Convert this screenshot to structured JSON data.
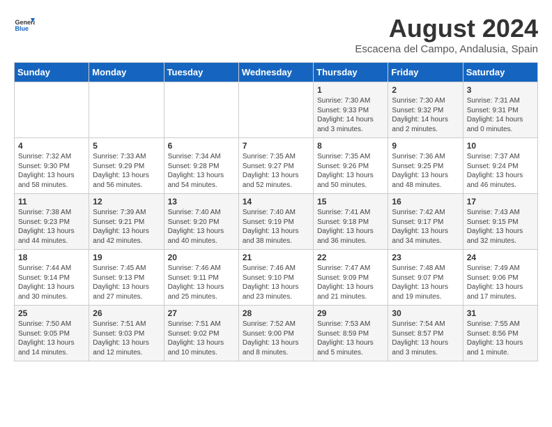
{
  "header": {
    "logo_general": "General",
    "logo_blue": "Blue",
    "month_year": "August 2024",
    "location": "Escacena del Campo, Andalusia, Spain"
  },
  "days_of_week": [
    "Sunday",
    "Monday",
    "Tuesday",
    "Wednesday",
    "Thursday",
    "Friday",
    "Saturday"
  ],
  "weeks": [
    [
      {
        "day": "",
        "content": ""
      },
      {
        "day": "",
        "content": ""
      },
      {
        "day": "",
        "content": ""
      },
      {
        "day": "",
        "content": ""
      },
      {
        "day": "1",
        "content": "Sunrise: 7:30 AM\nSunset: 9:33 PM\nDaylight: 14 hours\nand 3 minutes."
      },
      {
        "day": "2",
        "content": "Sunrise: 7:30 AM\nSunset: 9:32 PM\nDaylight: 14 hours\nand 2 minutes."
      },
      {
        "day": "3",
        "content": "Sunrise: 7:31 AM\nSunset: 9:31 PM\nDaylight: 14 hours\nand 0 minutes."
      }
    ],
    [
      {
        "day": "4",
        "content": "Sunrise: 7:32 AM\nSunset: 9:30 PM\nDaylight: 13 hours\nand 58 minutes."
      },
      {
        "day": "5",
        "content": "Sunrise: 7:33 AM\nSunset: 9:29 PM\nDaylight: 13 hours\nand 56 minutes."
      },
      {
        "day": "6",
        "content": "Sunrise: 7:34 AM\nSunset: 9:28 PM\nDaylight: 13 hours\nand 54 minutes."
      },
      {
        "day": "7",
        "content": "Sunrise: 7:35 AM\nSunset: 9:27 PM\nDaylight: 13 hours\nand 52 minutes."
      },
      {
        "day": "8",
        "content": "Sunrise: 7:35 AM\nSunset: 9:26 PM\nDaylight: 13 hours\nand 50 minutes."
      },
      {
        "day": "9",
        "content": "Sunrise: 7:36 AM\nSunset: 9:25 PM\nDaylight: 13 hours\nand 48 minutes."
      },
      {
        "day": "10",
        "content": "Sunrise: 7:37 AM\nSunset: 9:24 PM\nDaylight: 13 hours\nand 46 minutes."
      }
    ],
    [
      {
        "day": "11",
        "content": "Sunrise: 7:38 AM\nSunset: 9:23 PM\nDaylight: 13 hours\nand 44 minutes."
      },
      {
        "day": "12",
        "content": "Sunrise: 7:39 AM\nSunset: 9:21 PM\nDaylight: 13 hours\nand 42 minutes."
      },
      {
        "day": "13",
        "content": "Sunrise: 7:40 AM\nSunset: 9:20 PM\nDaylight: 13 hours\nand 40 minutes."
      },
      {
        "day": "14",
        "content": "Sunrise: 7:40 AM\nSunset: 9:19 PM\nDaylight: 13 hours\nand 38 minutes."
      },
      {
        "day": "15",
        "content": "Sunrise: 7:41 AM\nSunset: 9:18 PM\nDaylight: 13 hours\nand 36 minutes."
      },
      {
        "day": "16",
        "content": "Sunrise: 7:42 AM\nSunset: 9:17 PM\nDaylight: 13 hours\nand 34 minutes."
      },
      {
        "day": "17",
        "content": "Sunrise: 7:43 AM\nSunset: 9:15 PM\nDaylight: 13 hours\nand 32 minutes."
      }
    ],
    [
      {
        "day": "18",
        "content": "Sunrise: 7:44 AM\nSunset: 9:14 PM\nDaylight: 13 hours\nand 30 minutes."
      },
      {
        "day": "19",
        "content": "Sunrise: 7:45 AM\nSunset: 9:13 PM\nDaylight: 13 hours\nand 27 minutes."
      },
      {
        "day": "20",
        "content": "Sunrise: 7:46 AM\nSunset: 9:11 PM\nDaylight: 13 hours\nand 25 minutes."
      },
      {
        "day": "21",
        "content": "Sunrise: 7:46 AM\nSunset: 9:10 PM\nDaylight: 13 hours\nand 23 minutes."
      },
      {
        "day": "22",
        "content": "Sunrise: 7:47 AM\nSunset: 9:09 PM\nDaylight: 13 hours\nand 21 minutes."
      },
      {
        "day": "23",
        "content": "Sunrise: 7:48 AM\nSunset: 9:07 PM\nDaylight: 13 hours\nand 19 minutes."
      },
      {
        "day": "24",
        "content": "Sunrise: 7:49 AM\nSunset: 9:06 PM\nDaylight: 13 hours\nand 17 minutes."
      }
    ],
    [
      {
        "day": "25",
        "content": "Sunrise: 7:50 AM\nSunset: 9:05 PM\nDaylight: 13 hours\nand 14 minutes."
      },
      {
        "day": "26",
        "content": "Sunrise: 7:51 AM\nSunset: 9:03 PM\nDaylight: 13 hours\nand 12 minutes."
      },
      {
        "day": "27",
        "content": "Sunrise: 7:51 AM\nSunset: 9:02 PM\nDaylight: 13 hours\nand 10 minutes."
      },
      {
        "day": "28",
        "content": "Sunrise: 7:52 AM\nSunset: 9:00 PM\nDaylight: 13 hours\nand 8 minutes."
      },
      {
        "day": "29",
        "content": "Sunrise: 7:53 AM\nSunset: 8:59 PM\nDaylight: 13 hours\nand 5 minutes."
      },
      {
        "day": "30",
        "content": "Sunrise: 7:54 AM\nSunset: 8:57 PM\nDaylight: 13 hours\nand 3 minutes."
      },
      {
        "day": "31",
        "content": "Sunrise: 7:55 AM\nSunset: 8:56 PM\nDaylight: 13 hours\nand 1 minute."
      }
    ]
  ]
}
